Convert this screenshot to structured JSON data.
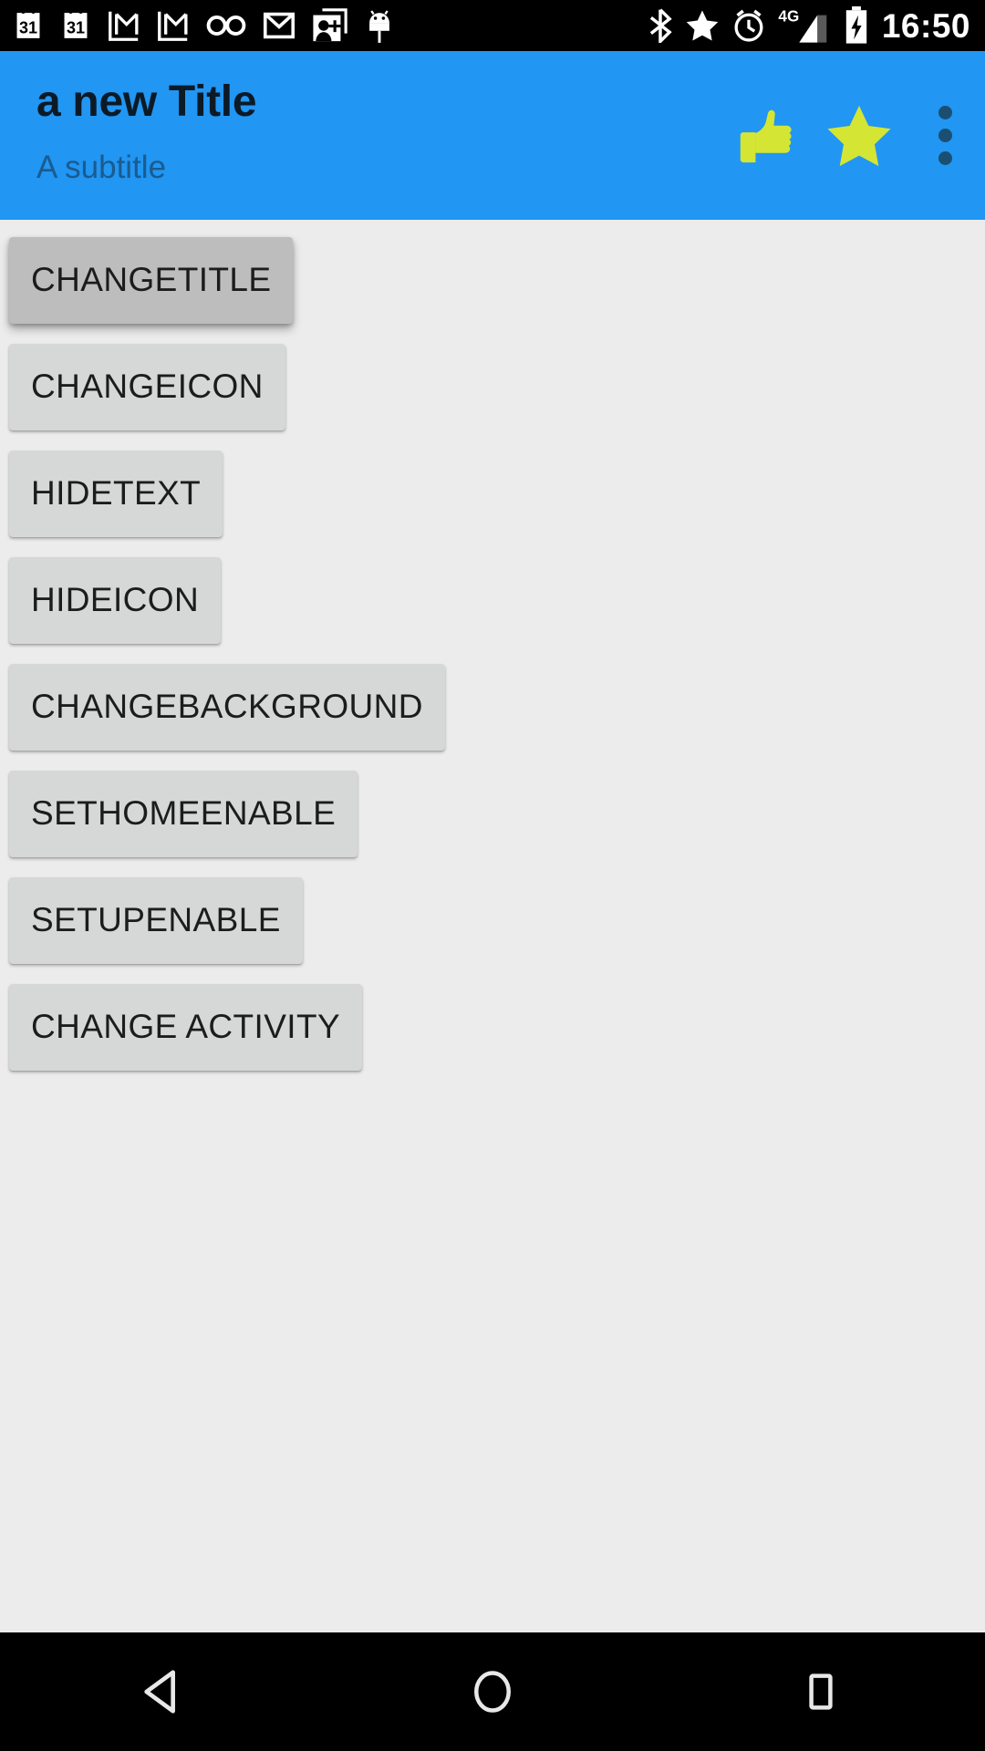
{
  "status_bar": {
    "icons": [
      {
        "name": "calendar-icon-1",
        "label": "31"
      },
      {
        "name": "calendar-icon-2",
        "label": "31"
      },
      {
        "name": "gmail-icon-1",
        "label": "M"
      },
      {
        "name": "gmail-icon-2",
        "label": "M"
      },
      {
        "name": "voicemail-icon",
        "label": "oo"
      },
      {
        "name": "gmail-icon-3",
        "label": "M"
      },
      {
        "name": "add-contact-icon",
        "label": "g+"
      },
      {
        "name": "android-icon",
        "label": "android"
      },
      {
        "name": "bluetooth-icon",
        "label": "bluetooth"
      },
      {
        "name": "star-status-icon",
        "label": "star"
      },
      {
        "name": "alarm-icon",
        "label": "alarm"
      }
    ],
    "network_type": "4G",
    "signal": "signal-bars-icon",
    "battery": "battery-charging-icon",
    "clock": "16:50",
    "background_color": "#000000",
    "foreground_color": "#FFFFFF"
  },
  "app_bar": {
    "title": "a new Title",
    "subtitle": "A subtitle",
    "background_color": "#2196F3",
    "title_color": "#0C1A26",
    "subtitle_color": "#1A5B8F",
    "accent_color": "#D4E534",
    "actions": [
      {
        "name": "thumb-up-icon",
        "label": "Thumb Up"
      },
      {
        "name": "star-icon",
        "label": "Star"
      }
    ],
    "overflow": {
      "name": "overflow-menu-icon",
      "label": "More options"
    }
  },
  "content": {
    "background_color": "#ECECEC",
    "buttons": [
      {
        "label": "CHANGETITLE",
        "name": "change-title-button",
        "pressed": true
      },
      {
        "label": "CHANGEICON",
        "name": "change-icon-button",
        "pressed": false
      },
      {
        "label": "HIDETEXT",
        "name": "hide-text-button",
        "pressed": false
      },
      {
        "label": "HIDEICON",
        "name": "hide-icon-button",
        "pressed": false
      },
      {
        "label": "CHANGEBACKGROUND",
        "name": "change-background-button",
        "pressed": false
      },
      {
        "label": "SETHOMEENABLE",
        "name": "set-home-enable-button",
        "pressed": false
      },
      {
        "label": "SETUPENABLE",
        "name": "set-up-enable-button",
        "pressed": false
      },
      {
        "label": "CHANGE ACTIVITY",
        "name": "change-activity-button",
        "pressed": false
      }
    ]
  },
  "nav_bar": {
    "background_color": "#000000",
    "buttons": [
      {
        "name": "nav-back-button",
        "label": "Back"
      },
      {
        "name": "nav-home-button",
        "label": "Home"
      },
      {
        "name": "nav-recents-button",
        "label": "Recents"
      }
    ]
  }
}
